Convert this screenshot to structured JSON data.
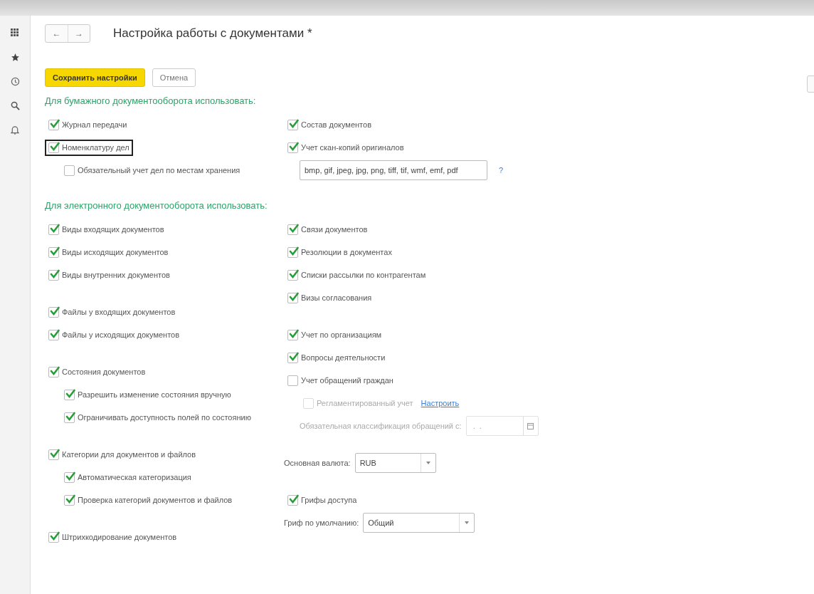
{
  "window": {
    "title": "Настройка работы с документами *"
  },
  "nav": {
    "back": "←",
    "forward": "→"
  },
  "buttons": [
    {
      "kind": "primary",
      "label": "Сохранить настройки"
    },
    {
      "kind": "plain",
      "label": "Отмена"
    }
  ],
  "paper": {
    "heading": "Для бумажного документооборота использовать:",
    "left": [
      [
        {
          "kind": "checkbox",
          "label": "Журнал передачи",
          "checked": true,
          "highlighted": false
        },
        {
          "kind": "checkbox",
          "label": "Номенклатуру дел",
          "checked": true,
          "highlighted": true,
          "children": [
            {
              "kind": "checkbox",
              "label": "Обязательный учет дел по местам хранения",
              "checked": false,
              "highlighted": false
            }
          ]
        }
      ]
    ],
    "right": [
      [
        {
          "kind": "checkbox",
          "label": "Состав документов",
          "checked": true,
          "highlighted": false
        },
        {
          "kind": "checkbox",
          "label": "Учет скан-копий оригиналов",
          "checked": true,
          "highlighted": false
        },
        {
          "kind": "text_field",
          "value": "bmp, gif, jpeg, jpg, png, tiff, tif, wmf, emf, pdf",
          "help": "?"
        }
      ]
    ]
  },
  "electronic": {
    "heading": "Для электронного документооборота использовать:",
    "left": [
      [
        {
          "kind": "checkbox",
          "label": "Виды входящих документов",
          "checked": true
        },
        {
          "kind": "checkbox",
          "label": "Виды исходящих документов",
          "checked": true
        },
        {
          "kind": "checkbox",
          "label": "Виды внутренних документов",
          "checked": true
        }
      ],
      [
        {
          "kind": "checkbox",
          "label": "Файлы у входящих документов",
          "checked": true
        },
        {
          "kind": "checkbox",
          "label": "Файлы у исходящих документов",
          "checked": true
        }
      ],
      [
        {
          "kind": "checkbox",
          "label": "Состояния документов",
          "checked": true,
          "children": [
            {
              "kind": "checkbox",
              "label": "Разрешить изменение состояния вручную",
              "checked": true
            },
            {
              "kind": "checkbox",
              "label": "Ограничивать доступность полей по состоянию",
              "checked": true
            }
          ]
        }
      ],
      [
        {
          "kind": "checkbox",
          "label": "Категории для документов и файлов",
          "checked": true,
          "children": [
            {
              "kind": "checkbox",
              "label": "Автоматическая категоризация",
              "checked": true
            },
            {
              "kind": "checkbox",
              "label": "Проверка категорий документов и файлов",
              "checked": true
            }
          ]
        }
      ],
      [
        {
          "kind": "checkbox",
          "label": "Штрихкодирование документов",
          "checked": true
        }
      ]
    ],
    "right": [
      [
        {
          "kind": "checkbox",
          "label": "Связи документов",
          "checked": true
        },
        {
          "kind": "checkbox",
          "label": "Резолюции в документах",
          "checked": true
        },
        {
          "kind": "checkbox",
          "label": "Списки рассылки по контрагентам",
          "checked": true
        },
        {
          "kind": "checkbox",
          "label": "Визы согласования",
          "checked": true
        }
      ],
      [
        {
          "kind": "checkbox",
          "label": "Учет по организациям",
          "checked": true
        },
        {
          "kind": "checkbox",
          "label": "Вопросы деятельности",
          "checked": true
        },
        {
          "kind": "checkbox",
          "label": "Учет обращений граждан",
          "checked": false,
          "children": [
            {
              "kind": "checkbox",
              "label": "Регламентированный учет",
              "checked": false,
              "disabled": true,
              "link": "Настроить"
            }
          ]
        },
        {
          "kind": "date_field",
          "label": "Обязательная классификация обращений с:",
          "placeholder": " .  . ",
          "disabled": true
        }
      ],
      [
        {
          "kind": "select",
          "label": "Основная валюта:",
          "value": "RUB"
        }
      ],
      [
        {
          "kind": "checkbox",
          "label": "Грифы доступа",
          "checked": true
        },
        {
          "kind": "select",
          "label": "Гриф по умолчанию:",
          "value": "Общий"
        }
      ]
    ]
  }
}
